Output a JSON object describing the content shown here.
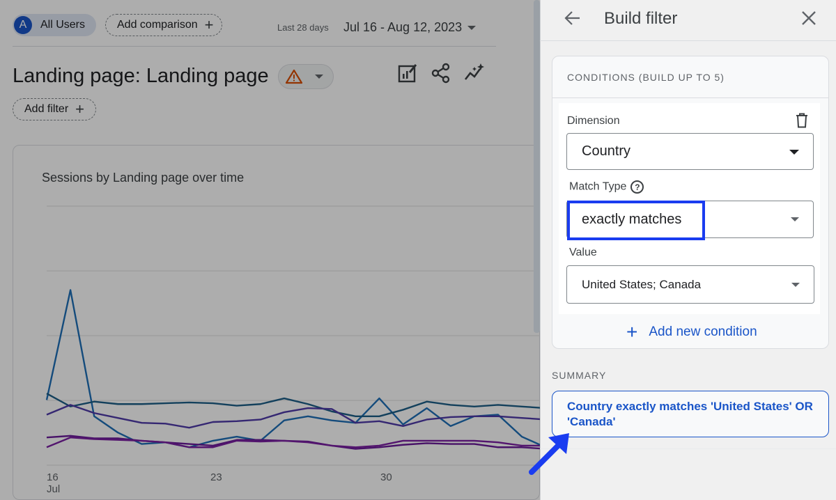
{
  "header": {
    "segment_avatar": "A",
    "segment_label": "All Users",
    "add_comparison_label": "Add comparison",
    "date_range_label": "Last 28 days",
    "date_range_value": "Jul 16 - Aug 12, 2023"
  },
  "page": {
    "title": "Landing page: Landing page",
    "add_filter_label": "Add filter"
  },
  "card": {
    "title": "Sessions by Landing page over time"
  },
  "chart_data": {
    "type": "line",
    "title": "Sessions by Landing page over time",
    "x": [
      16,
      17,
      18,
      19,
      20,
      21,
      22,
      23,
      24,
      25,
      26,
      27,
      28,
      29,
      30,
      31,
      32,
      33,
      34,
      35,
      36,
      37
    ],
    "x_tick_labels": [
      "16\nJul",
      "23",
      "30"
    ],
    "grid": true,
    "series": [
      {
        "color": "#1e6fb7",
        "values": [
          80,
          215,
          60,
          40,
          26,
          28,
          22,
          30,
          35,
          30,
          55,
          60,
          55,
          52,
          82,
          50,
          70,
          48,
          60,
          62,
          35,
          22
        ]
      },
      {
        "color": "#1d5f88",
        "values": [
          88,
          72,
          78,
          75,
          75,
          76,
          77,
          76,
          73,
          75,
          82,
          75,
          66,
          60,
          60,
          68,
          78,
          74,
          72,
          74,
          72,
          70
        ]
      },
      {
        "color": "#4e3aa8",
        "values": [
          62,
          74,
          64,
          58,
          52,
          51,
          46,
          53,
          54,
          56,
          65,
          70,
          69,
          52,
          54,
          48,
          56,
          59,
          60,
          60,
          58,
          56
        ]
      },
      {
        "color": "#6a1b9a",
        "values": [
          34,
          36,
          33,
          33,
          30,
          28,
          26,
          24,
          31,
          31,
          30,
          29,
          24,
          20,
          22,
          25,
          27,
          26,
          26,
          22,
          22,
          20
        ]
      },
      {
        "color": "#7b1fa2",
        "values": [
          22,
          34,
          32,
          31,
          30,
          28,
          22,
          22,
          30,
          29,
          30,
          28,
          24,
          22,
          24,
          30,
          30,
          30,
          30,
          28,
          24,
          24
        ]
      }
    ]
  },
  "panel": {
    "title": "Build filter",
    "conditions_header": "CONDITIONS (BUILD UP TO 5)",
    "dimension_label": "Dimension",
    "dimension_value": "Country",
    "match_type_label": "Match Type",
    "match_type_value": "exactly matches",
    "value_label": "Value",
    "value_value": "United States; Canada",
    "add_condition_label": "Add new condition",
    "summary_label": "SUMMARY",
    "summary_text": "Country exactly matches 'United States' OR 'Canada'",
    "help_icon_glyph": "?"
  },
  "colors": {
    "accent": "#1a55c8",
    "highlight_box": "#1a3cf0",
    "warning": "#d94f04"
  }
}
